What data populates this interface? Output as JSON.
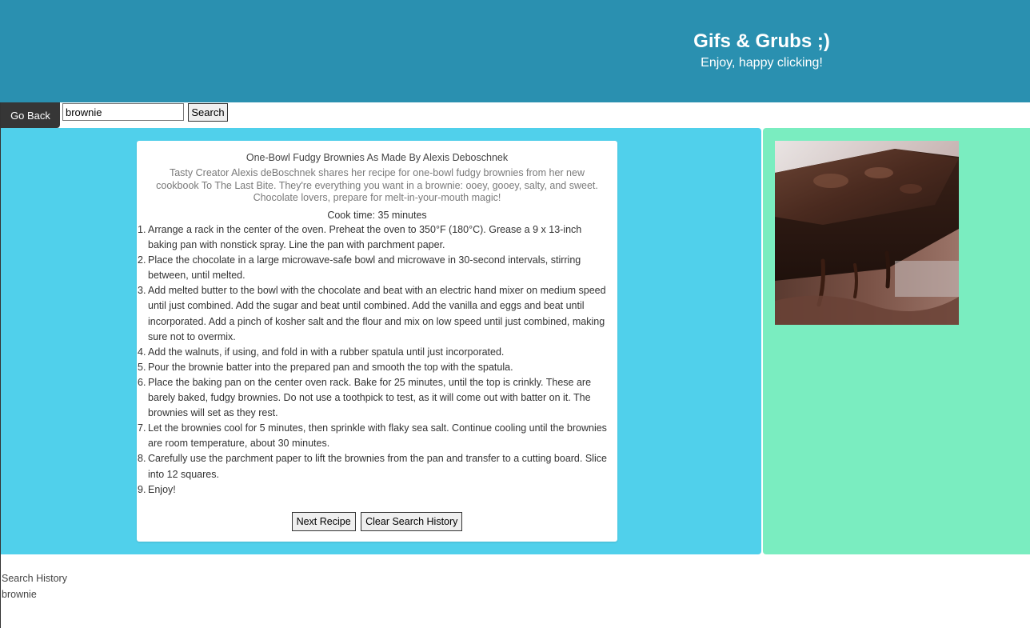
{
  "header": {
    "title": "Gifs & Grubs ;)",
    "subtitle": "Enjoy, happy clicking!"
  },
  "toolbar": {
    "go_back_label": "Go Back",
    "search_value": "brownie",
    "search_label": "Search"
  },
  "recipe": {
    "title": "One-Bowl Fudgy Brownies As Made By Alexis Deboschnek",
    "description": "Tasty Creator Alexis deBoschnek shares her recipe for one-bowl fudgy brownies from her new cookbook To The Last Bite. They're everything you want in a brownie: ooey, gooey, salty, and sweet. Chocolate lovers, prepare for melt-in-your-mouth magic!",
    "cook_time": "Cook time: 35 minutes",
    "steps": [
      {
        "num": "1.",
        "text": "Arrange a rack in the center of the oven. Preheat the oven to 350°F (180°C). Grease a 9 x 13-inch baking pan with nonstick spray. Line the pan with parchment paper."
      },
      {
        "num": "2.",
        "text": "Place the chocolate in a large microwave-safe bowl and microwave in 30-second intervals, stirring between, until melted."
      },
      {
        "num": "3.",
        "text": "Add melted butter to the bowl with the chocolate and beat with an electric hand mixer on medium speed until just combined. Add the sugar and beat until combined. Add the vanilla and eggs and beat until incorporated. Add a pinch of kosher salt and the flour and mix on low speed until just combined, making sure not to overmix."
      },
      {
        "num": "4.",
        "text": "Add the walnuts, if using, and fold in with a rubber spatula until just incorporated."
      },
      {
        "num": "5.",
        "text": "Pour the brownie batter into the prepared pan and smooth the top with the spatula."
      },
      {
        "num": "6.",
        "text": "Place the baking pan on the center oven rack. Bake for 25 minutes, until the top is crinkly. These are barely baked, fudgy brownies. Do not use a toothpick to test, as it will come out with batter on it. The brownies will set as they rest."
      },
      {
        "num": "7.",
        "text": "Let the brownies cool for 5 minutes, then sprinkle with flaky sea salt. Continue cooling until the brownies are room temperature, about 30 minutes."
      },
      {
        "num": "8.",
        "text": "Carefully use the parchment paper to lift the brownies from the pan and transfer to a cutting board. Slice into 12 squares."
      },
      {
        "num": "9.",
        "text": "Enjoy!"
      }
    ],
    "next_label": "Next Recipe",
    "clear_label": "Clear Search History"
  },
  "history": {
    "heading": "Search History",
    "items": [
      "brownie"
    ]
  },
  "colors": {
    "header": "#2a90b0",
    "recipe_panel": "#50d0eb",
    "gif_panel": "#7aedc0"
  }
}
